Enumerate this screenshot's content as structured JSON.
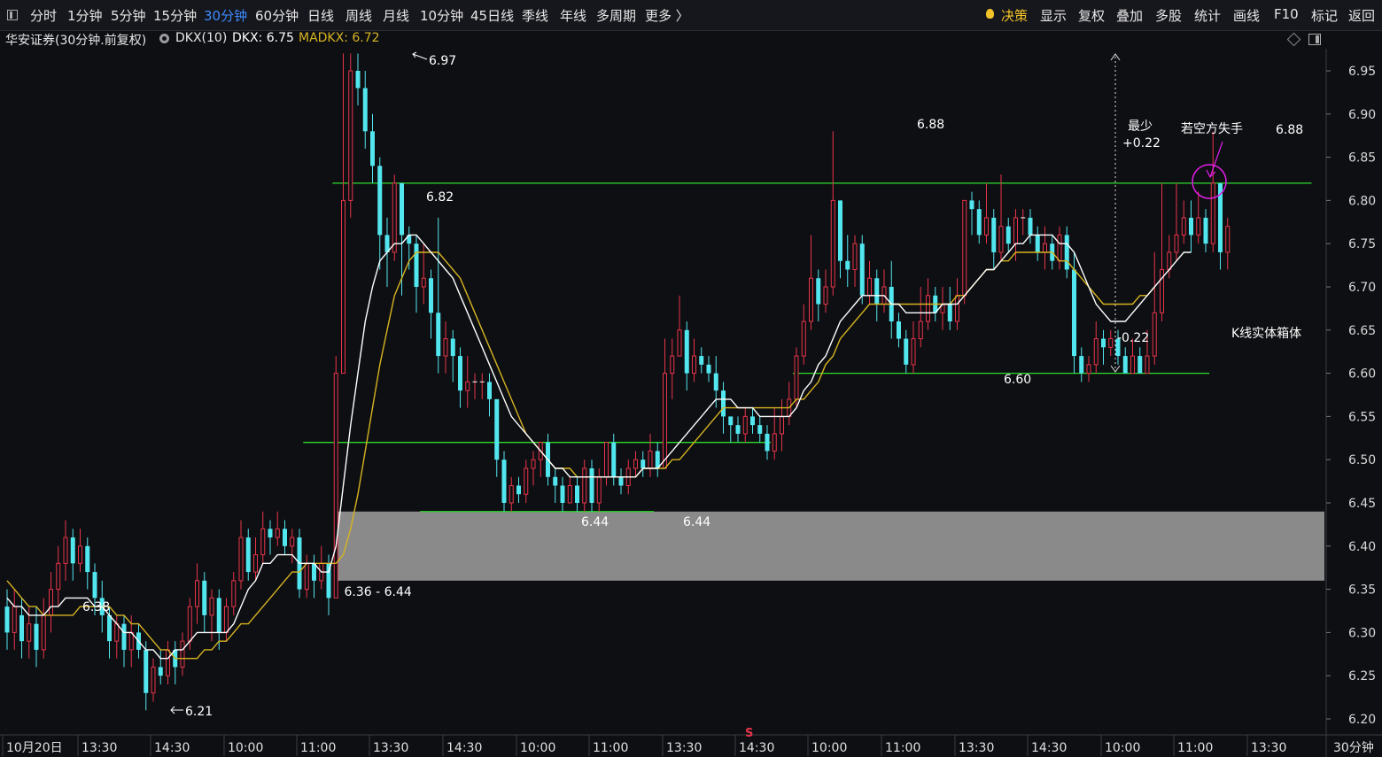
{
  "toolbar": {
    "periods": [
      {
        "label": "分时",
        "active": false
      },
      {
        "label": "1分钟",
        "active": false
      },
      {
        "label": "5分钟",
        "active": false
      },
      {
        "label": "15分钟",
        "active": false
      },
      {
        "label": "30分钟",
        "active": true
      },
      {
        "label": "60分钟",
        "active": false
      },
      {
        "label": "日线",
        "active": false
      },
      {
        "label": "周线",
        "active": false
      },
      {
        "label": "月线",
        "active": false
      },
      {
        "label": "10分钟",
        "active": false
      },
      {
        "label": "45日线",
        "active": false
      },
      {
        "label": "季线",
        "active": false
      },
      {
        "label": "年线",
        "active": false
      },
      {
        "label": "多周期",
        "active": false
      },
      {
        "label": "更多 〉",
        "active": false
      }
    ],
    "right": [
      {
        "label": "决策",
        "name": "decision-button"
      },
      {
        "label": "显示",
        "name": "display-button"
      },
      {
        "label": "复权",
        "name": "adjust-button"
      },
      {
        "label": "叠加",
        "name": "overlay-button"
      },
      {
        "label": "多股",
        "name": "multi-stock-button"
      },
      {
        "label": "统计",
        "name": "stats-button"
      },
      {
        "label": "画线",
        "name": "draw-line-button"
      },
      {
        "label": "F10",
        "name": "f10-button"
      },
      {
        "label": "标记",
        "name": "mark-button"
      },
      {
        "label": "返回",
        "name": "back-button"
      }
    ]
  },
  "info": {
    "stock_title": "华安证券(30分钟.前复权)",
    "indicator": "DKX(10)",
    "dkx": "DKX: 6.75",
    "madkx": "MADKX: 6.72"
  },
  "colors": {
    "up": "#e8344a",
    "down": "#52e6ef",
    "dkx": "#ffffff",
    "madkx": "#d6b421",
    "level": "#2bdc2b",
    "box": "#8a8a8a",
    "annot_magenta": "#e21ee8"
  },
  "chart_data": {
    "type": "candlestick",
    "ylim": [
      6.18,
      6.98
    ],
    "y_ticks": [
      "6.95",
      "6.90",
      "6.85",
      "6.80",
      "6.75",
      "6.70",
      "6.65",
      "6.60",
      "6.55",
      "6.50",
      "6.45",
      "6.40",
      "6.35",
      "6.30",
      "6.25",
      "6.20"
    ],
    "x_ticks": [
      "10月20日",
      "13:30",
      "14:30",
      "10:00",
      "11:00",
      "13:30",
      "14:30",
      "10:00",
      "11:00",
      "13:30",
      "14:30",
      "10:00",
      "11:00",
      "13:30",
      "14:30",
      "10:00",
      "11:00",
      "13:30"
    ],
    "x_unit": "30分钟",
    "candles": [
      [
        6.33,
        6.3,
        6.35,
        6.28
      ],
      [
        6.3,
        6.33,
        6.35,
        6.28
      ],
      [
        6.32,
        6.29,
        6.34,
        6.27
      ],
      [
        6.29,
        6.31,
        6.33,
        6.27
      ],
      [
        6.31,
        6.28,
        6.33,
        6.26
      ],
      [
        6.28,
        6.32,
        6.34,
        6.27
      ],
      [
        6.32,
        6.35,
        6.37,
        6.3
      ],
      [
        6.35,
        6.38,
        6.4,
        6.33
      ],
      [
        6.38,
        6.41,
        6.43,
        6.36
      ],
      [
        6.41,
        6.38,
        6.42,
        6.36
      ],
      [
        6.38,
        6.4,
        6.42,
        6.37
      ],
      [
        6.4,
        6.37,
        6.41,
        6.35
      ],
      [
        6.37,
        6.34,
        6.38,
        6.32
      ],
      [
        6.34,
        6.32,
        6.36,
        6.3
      ],
      [
        6.32,
        6.29,
        6.33,
        6.27
      ],
      [
        6.29,
        6.31,
        6.32,
        6.27
      ],
      [
        6.31,
        6.28,
        6.32,
        6.26
      ],
      [
        6.28,
        6.3,
        6.32,
        6.26
      ],
      [
        6.3,
        6.28,
        6.31,
        6.27
      ],
      [
        6.28,
        6.23,
        6.29,
        6.21
      ],
      [
        6.23,
        6.26,
        6.27,
        6.22
      ],
      [
        6.26,
        6.25,
        6.28,
        6.24
      ],
      [
        6.25,
        6.28,
        6.29,
        6.24
      ],
      [
        6.28,
        6.26,
        6.29,
        6.24
      ],
      [
        6.26,
        6.29,
        6.3,
        6.25
      ],
      [
        6.29,
        6.33,
        6.34,
        6.28
      ],
      [
        6.33,
        6.36,
        6.38,
        6.31
      ],
      [
        6.36,
        6.32,
        6.37,
        6.3
      ],
      [
        6.32,
        6.34,
        6.35,
        6.29
      ],
      [
        6.34,
        6.3,
        6.35,
        6.28
      ],
      [
        6.3,
        6.33,
        6.34,
        6.29
      ],
      [
        6.33,
        6.36,
        6.37,
        6.32
      ],
      [
        6.36,
        6.41,
        6.43,
        6.35
      ],
      [
        6.41,
        6.37,
        6.42,
        6.36
      ],
      [
        6.37,
        6.39,
        6.41,
        6.36
      ],
      [
        6.39,
        6.42,
        6.44,
        6.38
      ],
      [
        6.42,
        6.41,
        6.43,
        6.39
      ],
      [
        6.41,
        6.42,
        6.44,
        6.4
      ],
      [
        6.42,
        6.4,
        6.43,
        6.39
      ],
      [
        6.4,
        6.41,
        6.42,
        6.38
      ],
      [
        6.41,
        6.35,
        6.42,
        6.34
      ],
      [
        6.35,
        6.38,
        6.39,
        6.34
      ],
      [
        6.38,
        6.36,
        6.39,
        6.34
      ],
      [
        6.36,
        6.38,
        6.4,
        6.35
      ],
      [
        6.38,
        6.34,
        6.39,
        6.32
      ],
      [
        6.34,
        6.6,
        6.62,
        6.51
      ],
      [
        6.6,
        6.8,
        6.97,
        6.6
      ],
      [
        6.8,
        6.95,
        6.97,
        6.78
      ],
      [
        6.95,
        6.93,
        6.97,
        6.91
      ],
      [
        6.93,
        6.88,
        6.95,
        6.86
      ],
      [
        6.88,
        6.84,
        6.9,
        6.82
      ],
      [
        6.84,
        6.76,
        6.85,
        6.72
      ],
      [
        6.76,
        6.74,
        6.78,
        6.7
      ],
      [
        6.74,
        6.82,
        6.83,
        6.73
      ],
      [
        6.82,
        6.76,
        6.82,
        6.69
      ],
      [
        6.76,
        6.75,
        6.77,
        6.72
      ],
      [
        6.75,
        6.7,
        6.76,
        6.67
      ],
      [
        6.7,
        6.71,
        6.75,
        6.68
      ],
      [
        6.71,
        6.67,
        6.72,
        6.64
      ],
      [
        6.67,
        6.62,
        6.78,
        6.6
      ],
      [
        6.62,
        6.64,
        6.66,
        6.6
      ],
      [
        6.64,
        6.62,
        6.65,
        6.59
      ],
      [
        6.62,
        6.58,
        6.63,
        6.56
      ],
      [
        6.58,
        6.59,
        6.62,
        6.56
      ],
      [
        6.59,
        6.59,
        6.6,
        6.57
      ],
      [
        6.59,
        6.59,
        6.6,
        6.57
      ],
      [
        6.59,
        6.57,
        6.6,
        6.55
      ],
      [
        6.57,
        6.5,
        6.57,
        6.48
      ],
      [
        6.5,
        6.45,
        6.51,
        6.44
      ],
      [
        6.45,
        6.47,
        6.48,
        6.44
      ],
      [
        6.47,
        6.46,
        6.48,
        6.45
      ],
      [
        6.46,
        6.49,
        6.5,
        6.45
      ],
      [
        6.49,
        6.5,
        6.51,
        6.47
      ],
      [
        6.5,
        6.52,
        6.52,
        6.48
      ],
      [
        6.52,
        6.48,
        6.53,
        6.47
      ],
      [
        6.48,
        6.47,
        6.49,
        6.45
      ],
      [
        6.47,
        6.45,
        6.48,
        6.44
      ],
      [
        6.45,
        6.47,
        6.48,
        6.45
      ],
      [
        6.47,
        6.45,
        6.48,
        6.44
      ],
      [
        6.45,
        6.49,
        6.5,
        6.44
      ],
      [
        6.49,
        6.45,
        6.5,
        6.44
      ],
      [
        6.45,
        6.48,
        6.49,
        6.44
      ],
      [
        6.48,
        6.52,
        6.52,
        6.47
      ],
      [
        6.52,
        6.48,
        6.53,
        6.47
      ],
      [
        6.48,
        6.47,
        6.49,
        6.46
      ],
      [
        6.47,
        6.49,
        6.5,
        6.46
      ],
      [
        6.49,
        6.5,
        6.51,
        6.48
      ],
      [
        6.5,
        6.49,
        6.51,
        6.48
      ],
      [
        6.49,
        6.51,
        6.53,
        6.48
      ],
      [
        6.51,
        6.49,
        6.52,
        6.48
      ],
      [
        6.49,
        6.6,
        6.64,
        6.5
      ],
      [
        6.6,
        6.62,
        6.64,
        6.57
      ],
      [
        6.62,
        6.65,
        6.69,
        6.62
      ],
      [
        6.65,
        6.6,
        6.66,
        6.58
      ],
      [
        6.6,
        6.62,
        6.64,
        6.59
      ],
      [
        6.62,
        6.61,
        6.63,
        6.6
      ],
      [
        6.61,
        6.6,
        6.62,
        6.59
      ],
      [
        6.6,
        6.58,
        6.62,
        6.56
      ],
      [
        6.58,
        6.55,
        6.59,
        6.53
      ],
      [
        6.55,
        6.54,
        6.55,
        6.52
      ],
      [
        6.54,
        6.53,
        6.55,
        6.52
      ],
      [
        6.53,
        6.55,
        6.56,
        6.52
      ],
      [
        6.55,
        6.54,
        6.56,
        6.53
      ],
      [
        6.54,
        6.53,
        6.55,
        6.52
      ],
      [
        6.53,
        6.51,
        6.54,
        6.5
      ],
      [
        6.51,
        6.53,
        6.56,
        6.5
      ],
      [
        6.53,
        6.55,
        6.57,
        6.51
      ],
      [
        6.55,
        6.57,
        6.59,
        6.54
      ],
      [
        6.57,
        6.62,
        6.63,
        6.56
      ],
      [
        6.62,
        6.66,
        6.68,
        6.61
      ],
      [
        6.66,
        6.71,
        6.76,
        6.65
      ],
      [
        6.71,
        6.68,
        6.72,
        6.66
      ],
      [
        6.68,
        6.7,
        6.72,
        6.67
      ],
      [
        6.7,
        6.8,
        6.88,
        6.69
      ],
      [
        6.8,
        6.73,
        6.8,
        6.71
      ],
      [
        6.73,
        6.72,
        6.76,
        6.7
      ],
      [
        6.72,
        6.75,
        6.76,
        6.7
      ],
      [
        6.75,
        6.69,
        6.76,
        6.68
      ],
      [
        6.69,
        6.71,
        6.73,
        6.68
      ],
      [
        6.71,
        6.68,
        6.72,
        6.66
      ],
      [
        6.68,
        6.7,
        6.72,
        6.67
      ],
      [
        6.7,
        6.66,
        6.73,
        6.64
      ],
      [
        6.66,
        6.64,
        6.67,
        6.63
      ],
      [
        6.64,
        6.61,
        6.65,
        6.6
      ],
      [
        6.61,
        6.64,
        6.66,
        6.6
      ],
      [
        6.64,
        6.66,
        6.7,
        6.63
      ],
      [
        6.66,
        6.69,
        6.71,
        6.65
      ],
      [
        6.69,
        6.67,
        6.7,
        6.66
      ],
      [
        6.67,
        6.68,
        6.7,
        6.65
      ],
      [
        6.68,
        6.66,
        6.7,
        6.65
      ],
      [
        6.66,
        6.69,
        6.71,
        6.65
      ],
      [
        6.69,
        6.8,
        6.8,
        6.68
      ],
      [
        6.8,
        6.79,
        6.81,
        6.76
      ],
      [
        6.79,
        6.76,
        6.8,
        6.75
      ],
      [
        6.76,
        6.78,
        6.82,
        6.75
      ],
      [
        6.78,
        6.74,
        6.79,
        6.72
      ],
      [
        6.74,
        6.77,
        6.83,
        6.73
      ],
      [
        6.77,
        6.75,
        6.78,
        6.74
      ],
      [
        6.75,
        6.78,
        6.79,
        6.73
      ],
      [
        6.78,
        6.78,
        6.79,
        6.76
      ],
      [
        6.78,
        6.76,
        6.79,
        6.75
      ],
      [
        6.76,
        6.74,
        6.77,
        6.73
      ],
      [
        6.74,
        6.75,
        6.77,
        6.72
      ],
      [
        6.75,
        6.73,
        6.76,
        6.72
      ],
      [
        6.73,
        6.76,
        6.77,
        6.72
      ],
      [
        6.76,
        6.72,
        6.77,
        6.71
      ],
      [
        6.72,
        6.62,
        6.74,
        6.6
      ],
      [
        6.62,
        6.6,
        6.63,
        6.59
      ],
      [
        6.6,
        6.61,
        6.62,
        6.59
      ],
      [
        6.61,
        6.64,
        6.66,
        6.6
      ],
      [
        6.64,
        6.63,
        6.65,
        6.61
      ],
      [
        6.63,
        6.64,
        6.65,
        6.62
      ],
      [
        6.64,
        6.62,
        6.65,
        6.61
      ],
      [
        6.62,
        6.6,
        6.63,
        6.6
      ],
      [
        6.6,
        6.62,
        6.64,
        6.6
      ],
      [
        6.62,
        6.6,
        6.63,
        6.6
      ],
      [
        6.6,
        6.62,
        6.65,
        6.6
      ],
      [
        6.62,
        6.67,
        6.74,
        6.61
      ],
      [
        6.67,
        6.72,
        6.82,
        6.66
      ],
      [
        6.72,
        6.74,
        6.76,
        6.71
      ],
      [
        6.74,
        6.76,
        6.82,
        6.73
      ],
      [
        6.76,
        6.78,
        6.8,
        6.75
      ],
      [
        6.78,
        6.76,
        6.8,
        6.74
      ],
      [
        6.76,
        6.78,
        6.81,
        6.75
      ],
      [
        6.78,
        6.75,
        6.79,
        6.74
      ],
      [
        6.75,
        6.82,
        6.88,
        6.74
      ],
      [
        6.82,
        6.74,
        6.8,
        6.72
      ],
      [
        6.74,
        6.77,
        6.78,
        6.72
      ]
    ],
    "dkx": [
      6.34,
      6.33,
      6.33,
      6.32,
      6.32,
      6.32,
      6.33,
      6.33,
      6.34,
      6.34,
      6.34,
      6.34,
      6.33,
      6.33,
      6.32,
      6.31,
      6.3,
      6.3,
      6.29,
      6.28,
      6.28,
      6.27,
      6.27,
      6.28,
      6.28,
      6.29,
      6.3,
      6.3,
      6.3,
      6.3,
      6.3,
      6.31,
      6.33,
      6.35,
      6.36,
      6.38,
      6.38,
      6.39,
      6.39,
      6.39,
      6.38,
      6.38,
      6.38,
      6.37,
      6.37,
      6.4,
      6.47,
      6.54,
      6.6,
      6.66,
      6.7,
      6.73,
      6.74,
      6.75,
      6.75,
      6.76,
      6.76,
      6.75,
      6.74,
      6.73,
      6.72,
      6.71,
      6.69,
      6.67,
      6.65,
      6.63,
      6.61,
      6.59,
      6.57,
      6.55,
      6.54,
      6.53,
      6.52,
      6.51,
      6.5,
      6.49,
      6.49,
      6.48,
      6.48,
      6.48,
      6.48,
      6.48,
      6.48,
      6.48,
      6.48,
      6.48,
      6.48,
      6.49,
      6.49,
      6.49,
      6.5,
      6.51,
      6.52,
      6.53,
      6.54,
      6.55,
      6.56,
      6.57,
      6.57,
      6.57,
      6.56,
      6.56,
      6.56,
      6.55,
      6.55,
      6.55,
      6.55,
      6.55,
      6.56,
      6.58,
      6.59,
      6.61,
      6.62,
      6.64,
      6.66,
      6.67,
      6.68,
      6.69,
      6.69,
      6.69,
      6.69,
      6.68,
      6.68,
      6.67,
      6.67,
      6.67,
      6.67,
      6.67,
      6.68,
      6.68,
      6.68,
      6.69,
      6.7,
      6.71,
      6.72,
      6.72,
      6.73,
      6.74,
      6.75,
      6.75,
      6.76,
      6.76,
      6.76,
      6.76,
      6.75,
      6.75,
      6.74,
      6.72,
      6.7,
      6.68,
      6.67,
      6.66,
      6.66,
      6.66,
      6.67,
      6.68,
      6.69,
      6.7,
      6.71,
      6.72,
      6.73,
      6.74,
      6.74
    ],
    "madkx": [
      6.36,
      6.35,
      6.34,
      6.33,
      6.33,
      6.32,
      6.32,
      6.32,
      6.32,
      6.32,
      6.33,
      6.33,
      6.33,
      6.33,
      6.33,
      6.32,
      6.32,
      6.31,
      6.31,
      6.3,
      6.29,
      6.28,
      6.28,
      6.27,
      6.27,
      6.27,
      6.27,
      6.28,
      6.28,
      6.29,
      6.29,
      6.3,
      6.31,
      6.31,
      6.32,
      6.33,
      6.34,
      6.35,
      6.36,
      6.37,
      6.37,
      6.38,
      6.38,
      6.38,
      6.38,
      6.38,
      6.39,
      6.42,
      6.46,
      6.51,
      6.56,
      6.61,
      6.65,
      6.69,
      6.71,
      6.73,
      6.74,
      6.74,
      6.74,
      6.74,
      6.73,
      6.72,
      6.71,
      6.69,
      6.67,
      6.65,
      6.63,
      6.61,
      6.59,
      6.57,
      6.55,
      6.53,
      6.52,
      6.51,
      6.5,
      6.49,
      6.49,
      6.49,
      6.48,
      6.48,
      6.48,
      6.48,
      6.48,
      6.48,
      6.48,
      6.48,
      6.48,
      6.49,
      6.49,
      6.49,
      6.49,
      6.5,
      6.5,
      6.51,
      6.52,
      6.53,
      6.54,
      6.55,
      6.56,
      6.56,
      6.56,
      6.56,
      6.56,
      6.56,
      6.56,
      6.56,
      6.56,
      6.56,
      6.57,
      6.57,
      6.58,
      6.59,
      6.61,
      6.62,
      6.64,
      6.65,
      6.66,
      6.67,
      6.68,
      6.68,
      6.68,
      6.68,
      6.68,
      6.68,
      6.68,
      6.68,
      6.68,
      6.68,
      6.68,
      6.68,
      6.69,
      6.69,
      6.7,
      6.71,
      6.72,
      6.72,
      6.73,
      6.73,
      6.74,
      6.74,
      6.74,
      6.74,
      6.74,
      6.74,
      6.73,
      6.73,
      6.72,
      6.71,
      6.7,
      6.69,
      6.68,
      6.68,
      6.68,
      6.68,
      6.68,
      6.69,
      6.69,
      6.7
    ]
  },
  "levels": [
    {
      "price": 6.82,
      "from": 45,
      "to": 178
    },
    {
      "price": 6.52,
      "from": 41,
      "to": 104
    },
    {
      "price": 6.44,
      "from": 57,
      "to": 88
    },
    {
      "price": 6.6,
      "from": 108,
      "to": 164
    }
  ],
  "zone": {
    "low": 6.36,
    "high": 6.44,
    "from": 46,
    "label": "6.36 - 6.44"
  },
  "labels": {
    "low_621": "6.21",
    "v638": "6.38",
    "v697": "6.97",
    "v682": "6.82",
    "v644a": "6.44",
    "v644b": "6.44",
    "v688a": "6.88",
    "v660": "6.60",
    "v688b": "6.88",
    "min_label": "最少",
    "plus": "+0.22",
    "minus": "-0.22",
    "annot_loss": "若空方失手",
    "annot_box": "K线实体箱体",
    "s_marker": "S"
  }
}
